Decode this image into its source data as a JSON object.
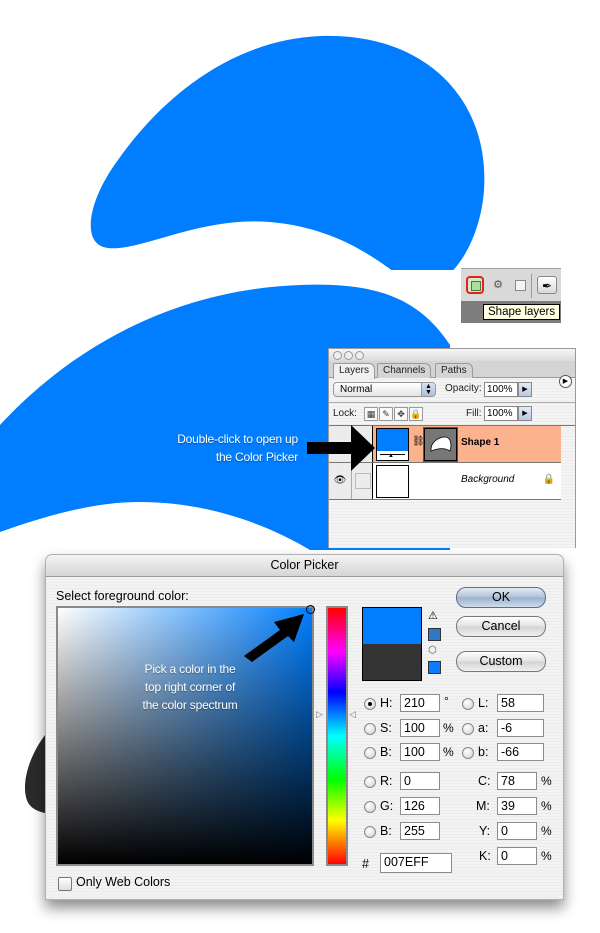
{
  "colors": {
    "shape_blue": "#007EFF",
    "dark_shape": "#2b2b2b",
    "selected_layer": "#FDB28E",
    "tooltip_bg": "#FFFFE1",
    "highlight_ring": "#E0221A",
    "current_color": "#333333",
    "gamut_swatch": "#2f78c8",
    "web_swatch": "#0f7bff"
  },
  "toolbar": {
    "buttons": [
      {
        "name": "shape-layers",
        "icon": "shape-layers-icon",
        "highlighted": true
      },
      {
        "name": "paths",
        "icon": "paths-icon"
      },
      {
        "name": "fill-pixels",
        "icon": "fill-pixels-icon"
      },
      {
        "name": "pen-tool",
        "icon": "pen-icon",
        "glyph": "✒"
      }
    ],
    "paths_glyph": "⚙",
    "tooltip": "Shape layers"
  },
  "annotations": {
    "layers_note_line1": "Double-click to open up",
    "layers_note_line2": "the Color Picker",
    "picker_note_line1": "Pick a color in the",
    "picker_note_line2": "top right corner of",
    "picker_note_line3": "the color spectrum"
  },
  "layers_panel": {
    "tabs": [
      "Layers",
      "Channels",
      "Paths"
    ],
    "active_tab": "Layers",
    "blend_mode": "Normal",
    "opacity_label": "Opacity:",
    "opacity": "100%",
    "lock_label": "Lock:",
    "fill_label": "Fill:",
    "fill": "100%",
    "lock_glyphs": [
      "▦",
      "✎",
      "✥",
      "🔒"
    ],
    "layers": [
      {
        "name": "Shape 1",
        "selected": true,
        "visible": false,
        "thumb_color": "#007EFF"
      },
      {
        "name": "Background",
        "selected": false,
        "visible": true,
        "locked": true
      }
    ],
    "eye_glyph": "👁",
    "chain_glyph": "⛓",
    "lock_glyph": "🔒",
    "menu_glyph": "▶",
    "step_glyph": "▶",
    "select_glyph": "▴▾"
  },
  "color_picker": {
    "title": "Color Picker",
    "prompt": "Select foreground color:",
    "buttons": {
      "ok": "OK",
      "cancel": "Cancel",
      "custom": "Custom"
    },
    "new_color": "#007EFF",
    "current_color": "#333333",
    "warning_glyph": "⚠",
    "cube_glyph": "⬡",
    "hsb": {
      "selected": "H",
      "H": "210",
      "S": "100",
      "B": "100",
      "h_unit": "°",
      "s_unit": "%",
      "b_unit": "%"
    },
    "lab": {
      "L": "58",
      "a": "-6",
      "b": "-66"
    },
    "rgb": {
      "R": "0",
      "G": "126",
      "B": "255"
    },
    "cmyk": {
      "C": "78",
      "M": "39",
      "Y": "0",
      "K": "0",
      "unit": "%"
    },
    "hex_label": "#",
    "hex": "007EFF",
    "labels": {
      "H": "H:",
      "S": "S:",
      "B": "B:",
      "L": "L:",
      "a": "a:",
      "b": "b:",
      "R": "R:",
      "G": "G:",
      "Bl": "B:",
      "C": "C:",
      "M": "M:",
      "Y": "Y:",
      "K": "K:"
    },
    "only_web_colors": "Only Web Colors",
    "only_web_colors_checked": false,
    "hue_left_glyph": "▷",
    "hue_right_glyph": "◁"
  }
}
